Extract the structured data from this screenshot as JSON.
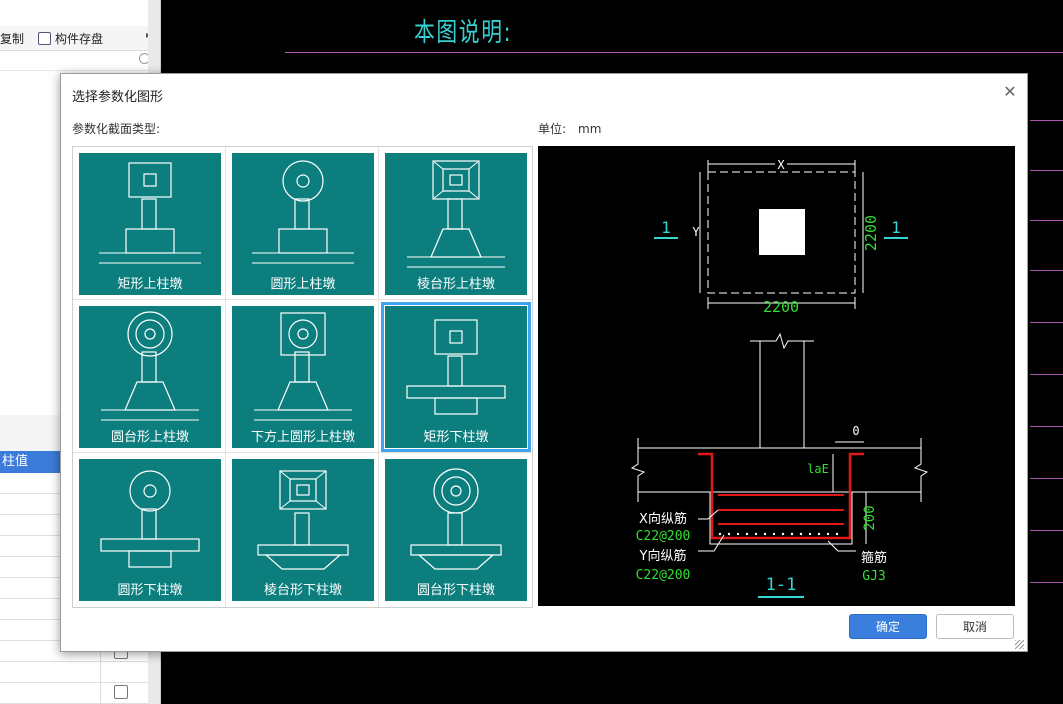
{
  "background": {
    "toolbar": {
      "copy_label": "复制",
      "save_label": "构件存盘"
    },
    "grid_header": "柱值",
    "cad_title": "本图说明:"
  },
  "dialog": {
    "title": "选择参数化图形",
    "section_type_label": "参数化截面类型:",
    "unit_label": "单位:",
    "unit_value": "mm",
    "shapes": [
      {
        "label": "矩形上柱墩",
        "top": "rect",
        "base": "upper-rect"
      },
      {
        "label": "圆形上柱墩",
        "top": "circle",
        "base": "upper-rect"
      },
      {
        "label": "棱台形上柱墩",
        "top": "frustum",
        "base": "upper-trap"
      },
      {
        "label": "圆台形上柱墩",
        "top": "concentric",
        "base": "upper-trap"
      },
      {
        "label": "下方上圆形上柱墩",
        "top": "square-circle",
        "base": "upper-trap"
      },
      {
        "label": "矩形下柱墩",
        "top": "rect",
        "base": "lower-rect"
      },
      {
        "label": "圆形下柱墩",
        "top": "circle",
        "base": "lower-rect"
      },
      {
        "label": "棱台形下柱墩",
        "top": "frustum",
        "base": "lower-trap"
      },
      {
        "label": "圆台形下柱墩",
        "top": "concentric",
        "base": "lower-trap"
      }
    ],
    "selected_index": 5,
    "preview": {
      "dim_x": "X",
      "dim_y": "Y",
      "plan_width": "2200",
      "plan_height": "2200",
      "section_mark": "1",
      "dim_zero": "0",
      "anchor_label": "laE",
      "depth": "200",
      "x_rebar_label": "X向纵筋",
      "x_rebar_spec": "C22@200",
      "y_rebar_label": "Y向纵筋",
      "y_rebar_spec": "C22@200",
      "stirrup_label": "箍筋",
      "stirrup_spec": "GJ3",
      "section_title": "1-1"
    },
    "ok_label": "确定",
    "cancel_label": "取消"
  }
}
